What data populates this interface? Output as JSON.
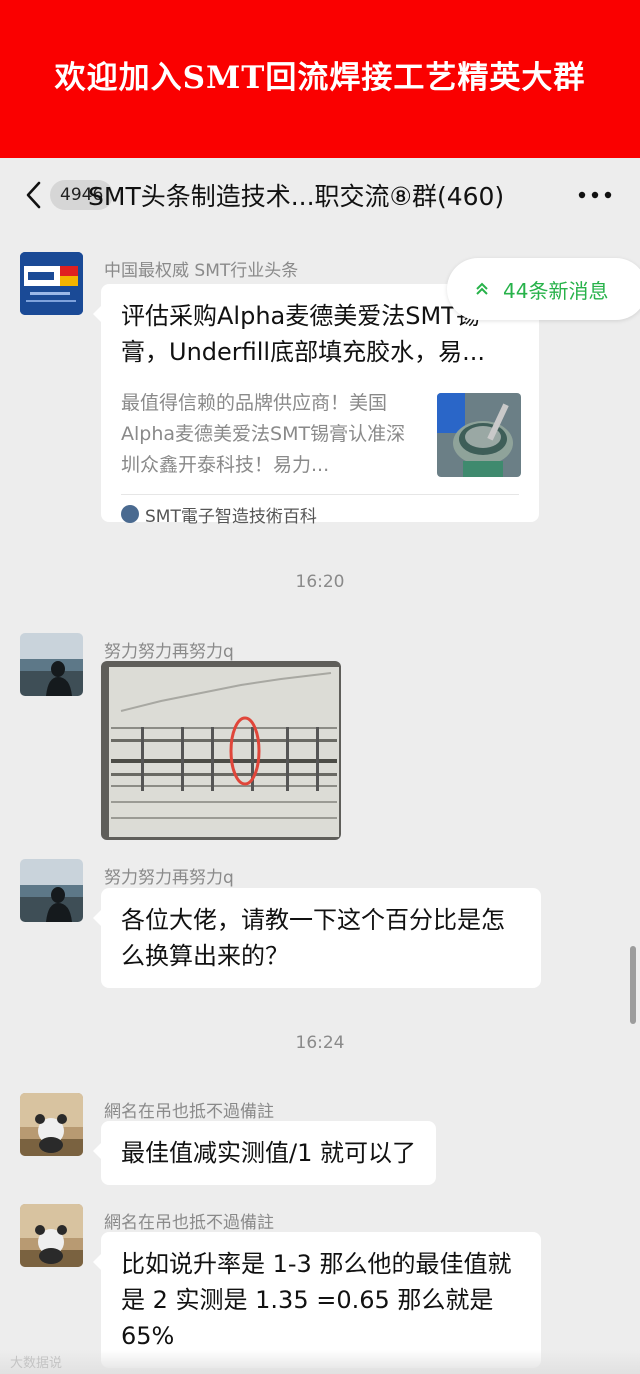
{
  "banner": {
    "text": "欢迎加入SMT回流焊接工艺精英大群"
  },
  "navbar": {
    "back_icon": "chevron-left-icon",
    "unread_count": "4946",
    "title": "SMT头条制造技术...职交流⑧群(460)",
    "more_icon": "ellipsis-icon"
  },
  "new_messages": {
    "label": "44条新消息",
    "icon": "double-chevron-up-icon",
    "color": "#27b24a"
  },
  "messages": [
    {
      "type": "card",
      "sender": "中国最权威 SMT行业头条",
      "card": {
        "title": "评估采购Alpha麦德美爱法SMT锡膏，Underfill底部填充胶水，易...",
        "description": "最值得信赖的品牌供应商！美国Alpha麦德美爱法SMT锡膏认准深圳众鑫开泰科技！易力...",
        "source": "SMT電子智造技術百科"
      }
    },
    {
      "type": "time",
      "text": "16:20"
    },
    {
      "type": "image",
      "sender": "努力努力再努力q"
    },
    {
      "type": "text",
      "sender": "努力努力再努力q",
      "text": "各位大佬，请教一下这个百分比是怎么换算出来的？"
    },
    {
      "type": "time",
      "text": "16:24"
    },
    {
      "type": "text",
      "sender": "網名在吊也抵不過備註",
      "text": "最佳值减实测值/1 就可以了"
    },
    {
      "type": "text",
      "sender": "網名在吊也抵不過備註",
      "text": "比如说升率是 1-3 那么他的最佳值就是 2  实测是 1.35 =0.65 那么就是65%"
    }
  ],
  "watermark": {
    "text": "大数据说"
  },
  "colors": {
    "banner": "#fa0000",
    "background": "#ededed",
    "accent_green": "#27b24a"
  }
}
